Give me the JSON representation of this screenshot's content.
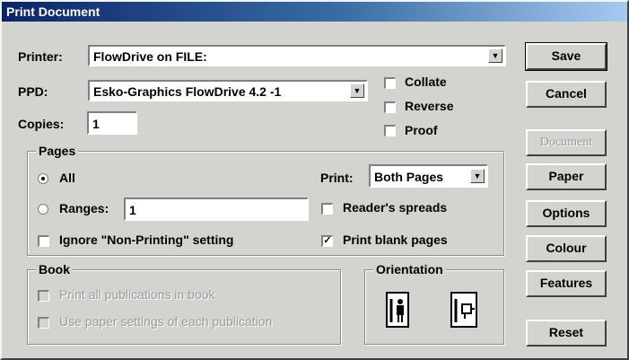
{
  "window": {
    "title": "Print Document"
  },
  "printer": {
    "label": "Printer:",
    "value": "FlowDrive on FILE:"
  },
  "ppd": {
    "label": "PPD:",
    "value": "Esko-Graphics FlowDrive 4.2 -1"
  },
  "copies": {
    "label": "Copies:",
    "value": "1"
  },
  "options": {
    "collate": {
      "label": "Collate",
      "checked": false
    },
    "reverse": {
      "label": "Reverse",
      "checked": false
    },
    "proof": {
      "label": "Proof",
      "checked": false
    }
  },
  "pages": {
    "title": "Pages",
    "all": {
      "label": "All",
      "selected": true
    },
    "ranges": {
      "label": "Ranges:",
      "value": "1",
      "selected": false
    },
    "print_label": "Print:",
    "print_value": "Both Pages",
    "readers_spreads": {
      "label": "Reader's spreads",
      "checked": false
    },
    "ignore_nonprinting": {
      "label": "Ignore \"Non-Printing\" setting",
      "checked": false
    },
    "print_blank": {
      "label": "Print blank pages",
      "checked": true
    }
  },
  "book": {
    "title": "Book",
    "print_all": {
      "label": "Print all publications in book",
      "checked": false
    },
    "use_paper": {
      "label": "Use paper settings of each publication",
      "checked": false
    }
  },
  "orientation": {
    "title": "Orientation",
    "selected": "portrait"
  },
  "buttons": {
    "save": "Save",
    "cancel": "Cancel",
    "document": "Document",
    "paper": "Paper",
    "options": "Options",
    "colour": "Colour",
    "features": "Features",
    "reset": "Reset"
  },
  "colors": {
    "title_start": "#0a246a",
    "title_end": "#a6caf0",
    "face": "#d3d3d0"
  }
}
